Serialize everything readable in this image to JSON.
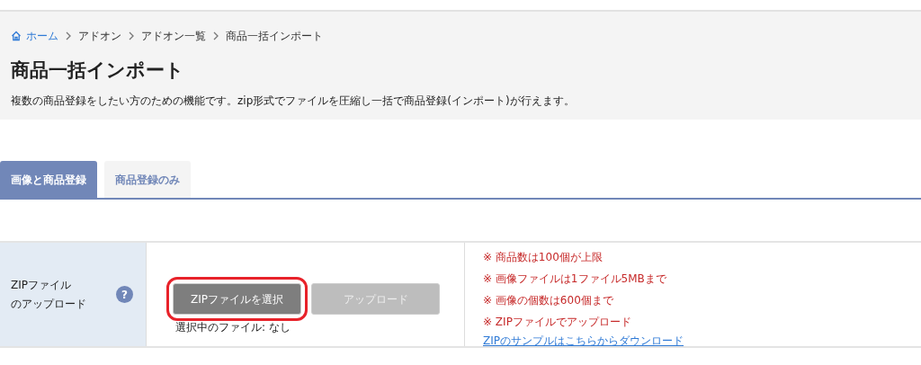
{
  "breadcrumb": [
    {
      "label": "ホーム",
      "kind": "home"
    },
    {
      "label": "アドオン",
      "kind": "plain"
    },
    {
      "label": "アドオン一覧",
      "kind": "plain"
    },
    {
      "label": "商品一括インポート",
      "kind": "plain"
    }
  ],
  "page": {
    "title": "商品一括インポート",
    "description": "複数の商品登録をしたい方のための機能です。zip形式でファイルを圧縮し一括で商品登録(インポート)が行えます。"
  },
  "tabs": [
    {
      "label": "画像と商品登録",
      "selected": true
    },
    {
      "label": "商品登録のみ",
      "selected": false
    }
  ],
  "upload": {
    "label_lines": [
      "ZIPファイル",
      "のアップロード"
    ],
    "help": "?",
    "buttons": [
      {
        "label": "ZIPファイルを選択",
        "disabled": false,
        "highlighted": true
      },
      {
        "label": "アップロード",
        "disabled": true,
        "highlighted": false
      }
    ],
    "selected_file": "選択中のファイル: なし",
    "notes": [
      "※ 商品数は100個が上限",
      "※ 画像ファイルは1ファイル5MBまで",
      "※ 画像の個数は600個まで",
      "※ ZIPファイルでアップロード"
    ],
    "sample_link": "ZIPのサンプルはこちらからダウンロード"
  }
}
